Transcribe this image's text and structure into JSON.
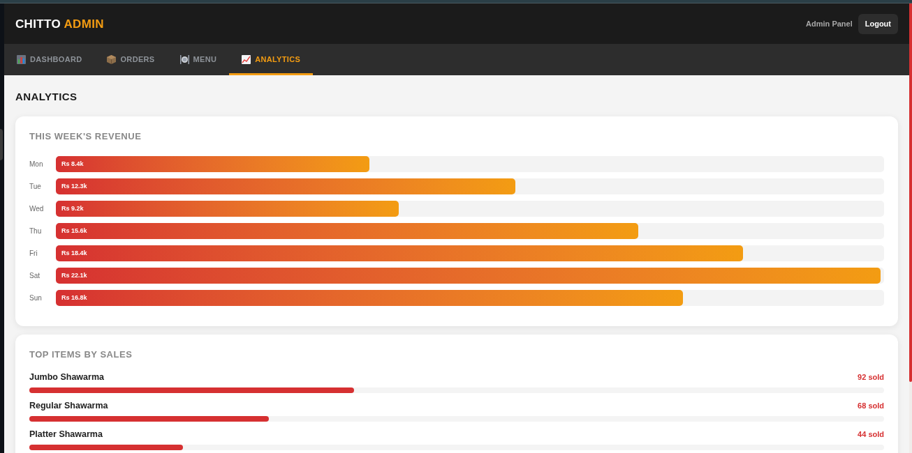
{
  "header": {
    "brand": {
      "text": "CHITTO",
      "accent": "ADMIN"
    },
    "caption": "Admin Panel",
    "logout_button": "Logout"
  },
  "nav": {
    "tabs": [
      {
        "label": "DASHBOARD",
        "kind": "bar-chart",
        "selected": false
      },
      {
        "label": "ORDERS",
        "kind": "box",
        "selected": false
      },
      {
        "label": "MENU",
        "kind": "plate",
        "selected": false
      },
      {
        "label": "ANALYTICS",
        "kind": "line-chart",
        "selected": true
      }
    ]
  },
  "page_title": "ANALYTICS",
  "revenue_card": {
    "title": "THIS WEEK'S REVENUE",
    "days": [
      {
        "day": "Mon",
        "amount": "Rs 8.4k",
        "level": 0.38
      },
      {
        "day": "Tue",
        "amount": "Rs 12.3k",
        "level": 0.557
      },
      {
        "day": "Wed",
        "amount": "Rs 9.2k",
        "level": 0.416
      },
      {
        "day": "Thu",
        "amount": "Rs 15.6k",
        "level": 0.706
      },
      {
        "day": "Fri",
        "amount": "Rs 18.4k",
        "level": 0.833
      },
      {
        "day": "Sat",
        "amount": "Rs 22.1k",
        "level": 1
      },
      {
        "day": "Sun",
        "amount": "Rs 16.8k",
        "level": 0.76
      }
    ]
  },
  "top_items_card": {
    "title": "TOP ITEMS BY SALES",
    "items": [
      {
        "name": "Jumbo Shawarma",
        "sold": "92 sold",
        "level": 0.38
      },
      {
        "name": "Regular Shawarma",
        "sold": "68 sold",
        "level": 0.28
      },
      {
        "name": "Platter Shawarma",
        "sold": "44 sold",
        "level": 0.18
      }
    ]
  }
}
